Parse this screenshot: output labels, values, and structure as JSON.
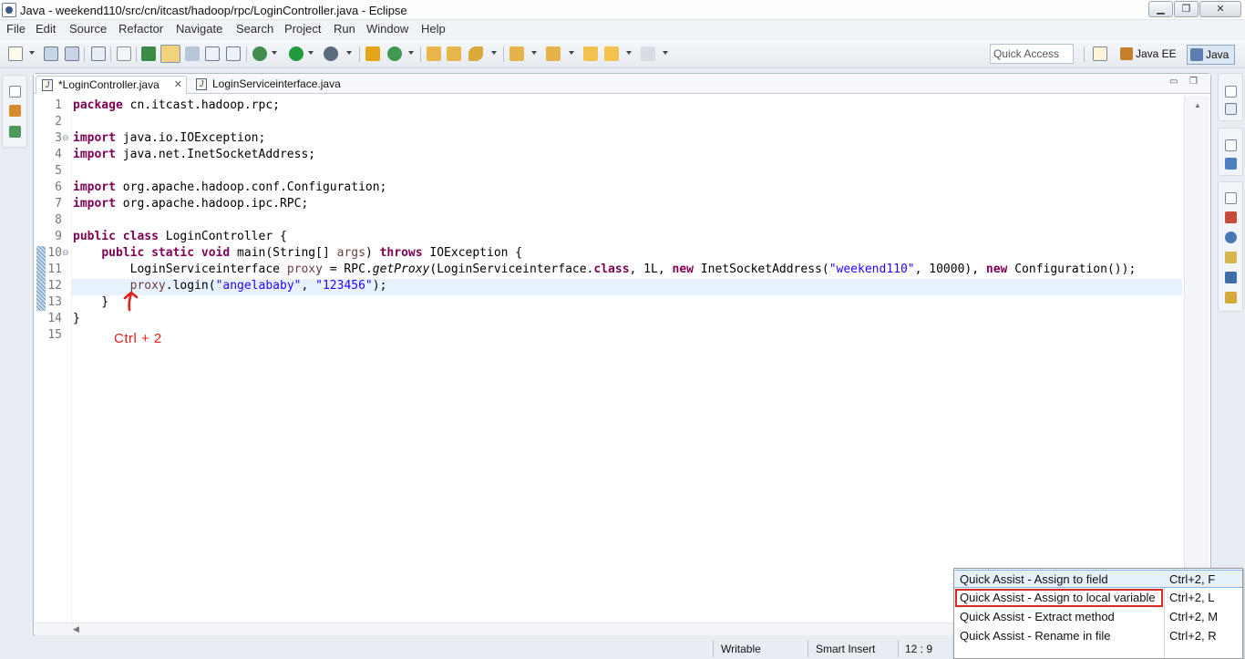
{
  "window": {
    "title": "Java - weekend110/src/cn/itcast/hadoop/rpc/LoginController.java - Eclipse",
    "min_label": "▁",
    "max_label": "❐",
    "close_label": "✕"
  },
  "menu": [
    "File",
    "Edit",
    "Source",
    "Refactor",
    "Navigate",
    "Search",
    "Project",
    "Run",
    "Window",
    "Help"
  ],
  "toolbar": {
    "quick_access_placeholder": "Quick Access",
    "perspectives": [
      "Java EE",
      "Java"
    ],
    "colors": {
      "run": "#1f9a3c",
      "debug": "#2e8b57",
      "accent": "#e6a417"
    }
  },
  "editor": {
    "tabs": [
      {
        "label": "*LoginController.java",
        "active": true,
        "icon": "java-file-icon"
      },
      {
        "label": "LoginServiceinterface.java",
        "active": false,
        "icon": "java-file-icon"
      }
    ],
    "icon_letter": "J",
    "tab_close": "✕",
    "min_label": "▭",
    "max_label": "❐",
    "line_numbers": [
      "1",
      "2",
      "3",
      "4",
      "5",
      "6",
      "7",
      "8",
      "9",
      "10",
      "11",
      "12",
      "13",
      "14",
      "15"
    ],
    "fold_marker": "⊖",
    "code": {
      "l1": {
        "kw": "package",
        "rest": " cn.itcast.hadoop.rpc;"
      },
      "l3": {
        "kw": "import",
        "rest": " java.io.IOException;"
      },
      "l4": {
        "kw": "import",
        "rest": " java.net.InetSocketAddress;"
      },
      "l6": {
        "kw": "import",
        "rest": " org.apache.hadoop.conf.Configuration;"
      },
      "l7": {
        "kw": "import",
        "rest": " org.apache.hadoop.ipc.RPC;"
      },
      "l9": {
        "kw1": "public",
        "kw2": "class",
        "rest": " LoginController {"
      },
      "l10": {
        "indent": "    ",
        "kw1": "public",
        "kw2": "static",
        "kw3": "void",
        "a": " main(String[] ",
        "param": "args",
        "b": ") ",
        "kw4": "throws",
        "c": " IOException {"
      },
      "l11": {
        "indent": "        ",
        "a": "LoginServiceinterface ",
        "var": "proxy",
        "b": " = RPC.",
        "method": "getProxy",
        "c": "(LoginServiceinterface.",
        "kw1": "class",
        "d": ", 1L, ",
        "kw2": "new",
        "e": " InetSocketAddress(",
        "s1": "\"weekend110\"",
        "f": ", 10000), ",
        "kw3": "new",
        "g": " Configuration());"
      },
      "l12": {
        "indent": "        ",
        "var": "proxy",
        "a": ".login(",
        "s1": "\"angelababy\"",
        "b": ", ",
        "s2": "\"123456\"",
        "c": ");"
      },
      "l13": {
        "text": "    }"
      },
      "l14": {
        "text": "}"
      }
    }
  },
  "annotation": {
    "text": "Ctrl  +  2",
    "color": "#e6201c"
  },
  "status": {
    "writable": "Writable",
    "insert_mode": "Smart Insert",
    "position": "12 : 9"
  },
  "quick_assist": {
    "items": [
      {
        "label": "Quick Assist - Assign to field",
        "shortcut": "Ctrl+2, F"
      },
      {
        "label": "Quick Assist - Assign to local variable",
        "shortcut": "Ctrl+2, L"
      },
      {
        "label": "Quick Assist - Extract method",
        "shortcut": "Ctrl+2, M"
      },
      {
        "label": "Quick Assist - Rename in file",
        "shortcut": "Ctrl+2, R"
      }
    ],
    "highlight_color": "#d62a22"
  }
}
